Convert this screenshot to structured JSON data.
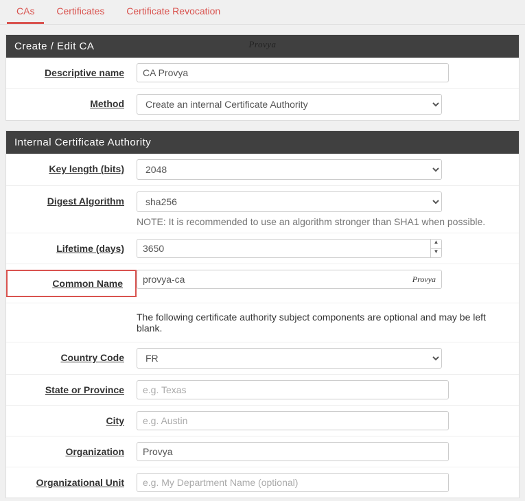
{
  "tabs": [
    {
      "label": "CAs",
      "active": true
    },
    {
      "label": "Certificates",
      "active": false
    },
    {
      "label": "Certificate Revocation",
      "active": false
    }
  ],
  "panel1": {
    "title": "Create / Edit CA",
    "watermark": "Provya",
    "rows": {
      "descriptive_name": {
        "label": "Descriptive name",
        "value": "CA Provya"
      },
      "method": {
        "label": "Method",
        "value": "Create an internal Certificate Authority"
      }
    }
  },
  "panel2": {
    "title": "Internal Certificate Authority",
    "rows": {
      "key_length": {
        "label": "Key length (bits)",
        "value": "2048"
      },
      "digest": {
        "label": "Digest Algorithm",
        "value": "sha256",
        "help": "NOTE: It is recommended to use an algorithm stronger than SHA1 when possible."
      },
      "lifetime": {
        "label": "Lifetime (days)",
        "value": "3650"
      },
      "common_name": {
        "label": "Common Name",
        "value": "provya-ca",
        "watermark": "Provya"
      },
      "optional_info": "The following certificate authority subject components are optional and may be left blank.",
      "country": {
        "label": "Country Code",
        "value": "FR"
      },
      "state": {
        "label": "State or Province",
        "value": "",
        "placeholder": "e.g. Texas"
      },
      "city": {
        "label": "City",
        "value": "",
        "placeholder": "e.g. Austin"
      },
      "organization": {
        "label": "Organization",
        "value": "Provya"
      },
      "ou": {
        "label": "Organizational Unit",
        "value": "",
        "placeholder": "e.g. My Department Name (optional)"
      }
    }
  }
}
